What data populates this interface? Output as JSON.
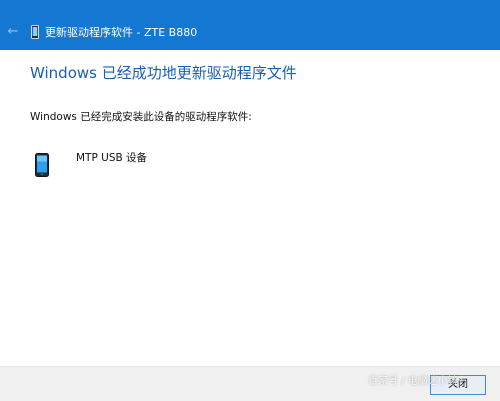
{
  "window": {
    "title": "更新驱动程序软件 - ZTE B880",
    "accent_color": "#1477d2",
    "back_icon": "back-arrow-icon",
    "title_icon": "mobile-device-icon"
  },
  "main": {
    "heading": "Windows 已经成功地更新驱动程序文件",
    "heading_color": "#1a5fb4",
    "status": "Windows 已经完成安装此设备的驱动程序软件:",
    "device": {
      "icon": "mobile-device-icon",
      "name": "MTP USB 设备"
    }
  },
  "footer": {
    "close_label": "关闭"
  },
  "watermark": {
    "text": "百家号 / 电脑迷小镜"
  }
}
